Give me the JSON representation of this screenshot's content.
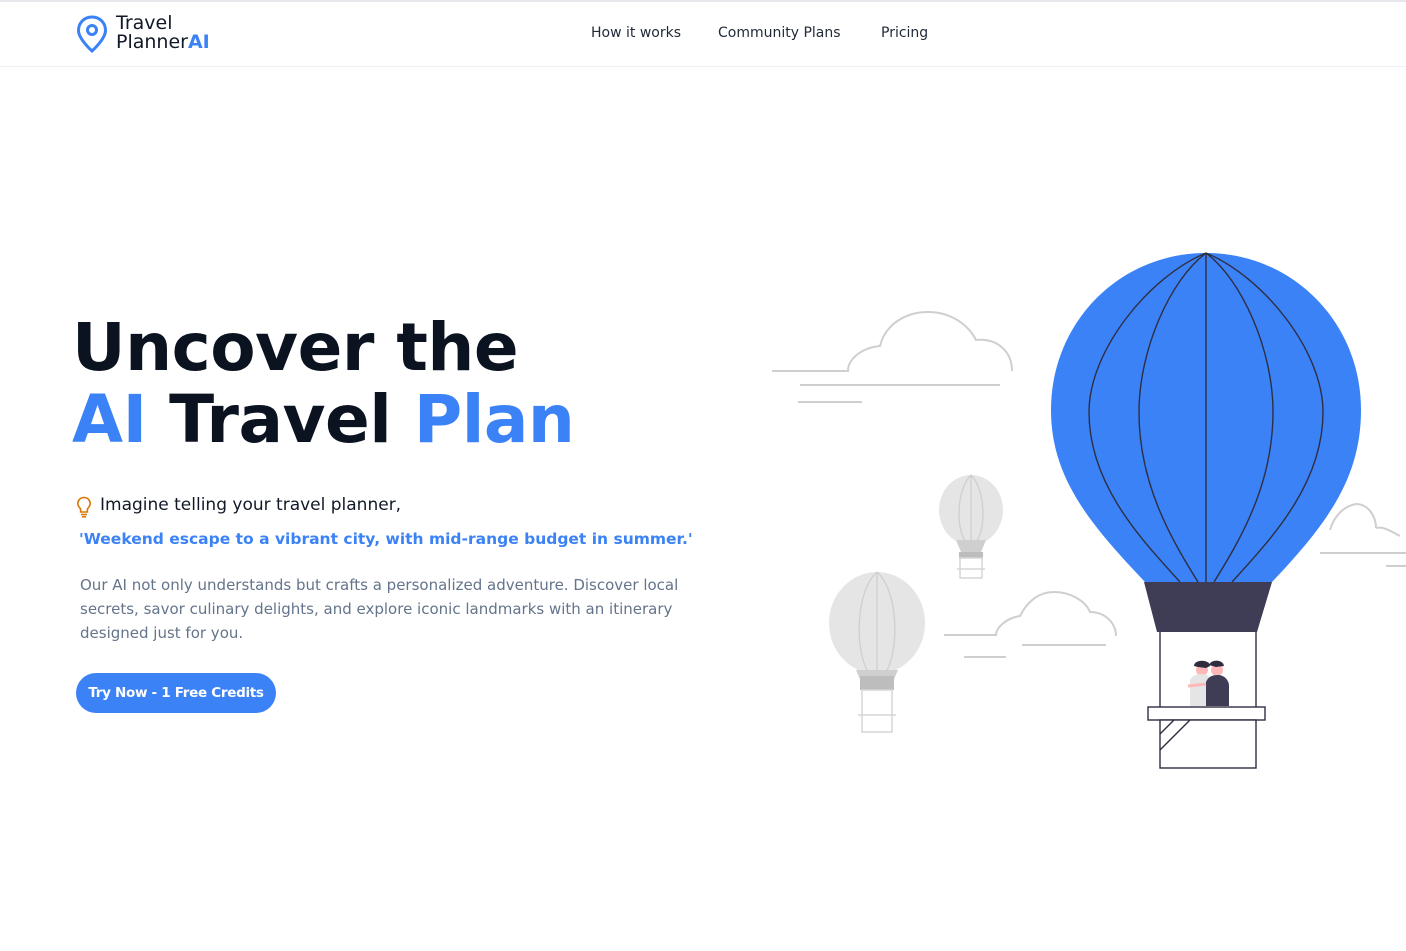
{
  "brand": {
    "line1": "Travel",
    "line2": "Planner",
    "accent": "AI",
    "accent_color": "#3b82f6",
    "icon": "location-pin-icon"
  },
  "nav": {
    "items": [
      {
        "label": "How it works"
      },
      {
        "label": "Community Plans"
      },
      {
        "label": "Pricing"
      }
    ]
  },
  "hero": {
    "title_line1": "Uncover the",
    "title_ai": "AI",
    "title_travel": "Travel",
    "title_plan": "Plan",
    "hint_icon": "lightbulb-icon",
    "hint": "Imagine telling your travel planner,",
    "quote": "'Weekend escape to a vibrant city, with mid-range budget in summer.'",
    "description": "Our AI not only understands but crafts a personalized adventure. Discover local secrets, savor culinary delights, and explore iconic landmarks with an itinerary designed just for you.",
    "cta_label": "Try Now - 1 Free Credits"
  },
  "illustration": {
    "name": "hot-air-balloon-illustration",
    "balloon_color": "#3b82f6",
    "basket_color": "#3f3d56"
  }
}
